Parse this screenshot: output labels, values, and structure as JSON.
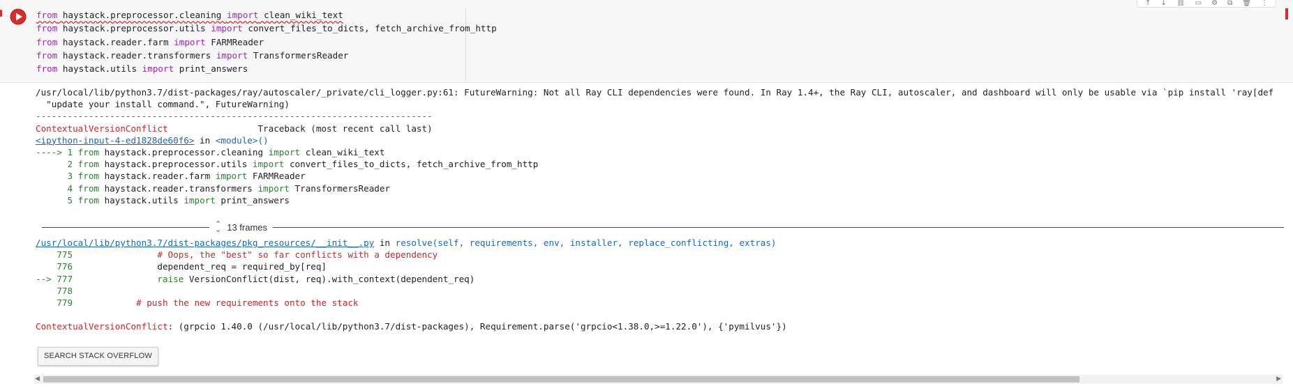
{
  "cell": {
    "code_lines": [
      {
        "kw1": "from",
        "mod": " haystack.preprocessor.cleaning ",
        "kw2": "import",
        "name": " clean_wiki_text"
      },
      {
        "kw1": "from",
        "mod": " haystack.preprocessor.utils ",
        "kw2": "import",
        "name": " convert_files_to_dicts, fetch_archive_from_http"
      },
      {
        "kw1": "from",
        "mod": " haystack.reader.farm ",
        "kw2": "import",
        "name": " FARMReader"
      },
      {
        "kw1": "from",
        "mod": " haystack.reader.transformers ",
        "kw2": "import",
        "name": " TransformersReader"
      },
      {
        "kw1": "from",
        "mod": " haystack.utils ",
        "kw2": "import",
        "name": " print_answers"
      }
    ]
  },
  "toolbar": {
    "icons": [
      "arrow-up-icon",
      "arrow-down-icon",
      "link-icon",
      "comment-icon",
      "gear-icon",
      "copy-icon",
      "trash-icon",
      "more-icon"
    ]
  },
  "output": {
    "warning_line1": "/usr/local/lib/python3.7/dist-packages/ray/autoscaler/_private/cli_logger.py:61: FutureWarning: Not all Ray CLI dependencies were found. In Ray 1.4+, the Ray CLI, autoscaler, and dashboard will only be usable via `pip install 'ray[def",
    "warning_line2": "  \"update your install command.\", FutureWarning)",
    "separator": "---------------------------------------------------------------------------",
    "error_name": "ContextualVersionConflict",
    "traceback_label": "Traceback (most recent call last)",
    "input_link": "<ipython-input-4-ed1828de60f6>",
    "in_word": " in ",
    "module": "<module>()",
    "tb_lines": [
      {
        "num": "----> 1",
        "mod": " haystack.preprocessor.cleaning ",
        "name": " clean_wiki_text"
      },
      {
        "num": "      2",
        "mod": " haystack.preprocessor.utils ",
        "name": " convert_files_to_dicts, fetch_archive_from_http"
      },
      {
        "num": "      3",
        "mod": " haystack.reader.farm ",
        "name": " FARMReader"
      },
      {
        "num": "      4",
        "mod": " haystack.reader.transformers ",
        "name": " TransformersReader"
      },
      {
        "num": "      5",
        "mod": " haystack.utils ",
        "name": " print_answers"
      }
    ],
    "from_kw": " from",
    "import_kw": "import",
    "frames_label": "13 frames",
    "file_link": "/usr/local/lib/python3.7/dist-packages/pkg_resources/__init__.py",
    "func_sig": "resolve(self, requirements, env, installer, replace_conflicting, extras)",
    "src_lines": [
      {
        "num": "    775",
        "text": "                # Oops, the \"best\" so far conflicts with a dependency",
        "kind": "comment"
      },
      {
        "num": "    776",
        "text": "                dependent_req = required_by[req]",
        "kind": "code"
      },
      {
        "num": "--> 777",
        "text": "                raise VersionConflict(dist, req).with_context(dependent_req)",
        "kind": "raise"
      },
      {
        "num": "    778",
        "text": "",
        "kind": "code"
      },
      {
        "num": "    779",
        "text": "            # push the new requirements onto the stack",
        "kind": "comment"
      }
    ],
    "final_error_name": "ContextualVersionConflict",
    "final_error_msg": ": (grpcio 1.40.0 (/usr/local/lib/python3.7/dist-packages), Requirement.parse('grpcio<1.38.0,>=1.22.0'), {'pymilvus'})"
  },
  "buttons": {
    "search_stack_overflow": "SEARCH STACK OVERFLOW"
  },
  "colors": {
    "keyword": "#9c27b0",
    "error": "#c62828",
    "line_number": "#2e7d32",
    "link": "#1565c0"
  }
}
